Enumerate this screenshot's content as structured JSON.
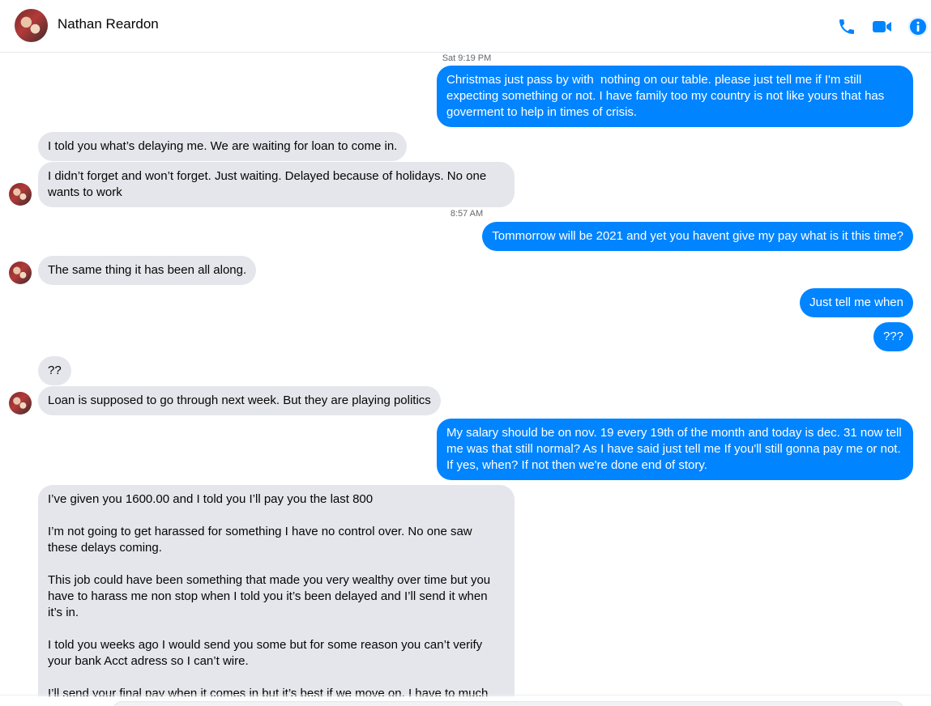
{
  "header": {
    "contact_name": "Nathan Reardon",
    "actions": [
      {
        "name": "phone-icon",
        "label": "Start a voice call"
      },
      {
        "name": "video-camera-icon",
        "label": "Start a video chat"
      },
      {
        "name": "info-icon",
        "label": "Conversation information"
      }
    ]
  },
  "colors": {
    "outgoing_bubble": "#0084ff",
    "incoming_bubble": "#e4e6eb",
    "accent": "#0084ff"
  },
  "timestamps": {
    "t1": "Sat 9:19 PM",
    "t2": "8:57 AM"
  },
  "messages": {
    "m1": "Christmas just pass by with  nothing on our table. please just tell me if I'm still expecting something or not. I have family too my country is not like yours that has goverment to help in times of crisis.",
    "m2": "I told you what’s delaying me. We are waiting for loan to come in.",
    "m3": "I didn’t forget and won’t forget. Just waiting. Delayed because of holidays. No one wants to work",
    "m4": "Tommorrow will be 2021 and yet you havent give my pay what is it this time?",
    "m5": "The same thing it has been all along.",
    "m6": "Just tell me when",
    "m7": "???",
    "m8": "??",
    "m9": "Loan is supposed to go through next week. But they are playing politics",
    "m10": "My salary should be on nov. 19 every 19th of the month and today is dec. 31 now tell me was that still normal? As I have said just tell me If you'll still gonna pay me or not. If yes, when? If not then we're done end of story.",
    "m11": "I’ve given you 1600.00 and I told you I’ll pay you the last 800\n\nI’m not going to get harassed for something I have no control over. No one saw these delays coming.\n\nThis job could have been something that made you very wealthy over time but you have to harass me non stop when I told you it’s been delayed and I’ll send it when it’s in.\n\nI told you weeks ago I would send you some but for some reason you can’t verify your bank Acct adress so I can’t wire.\n\nI’ll send your final pay when it comes in but it’s best if we move on. I have to much"
  }
}
